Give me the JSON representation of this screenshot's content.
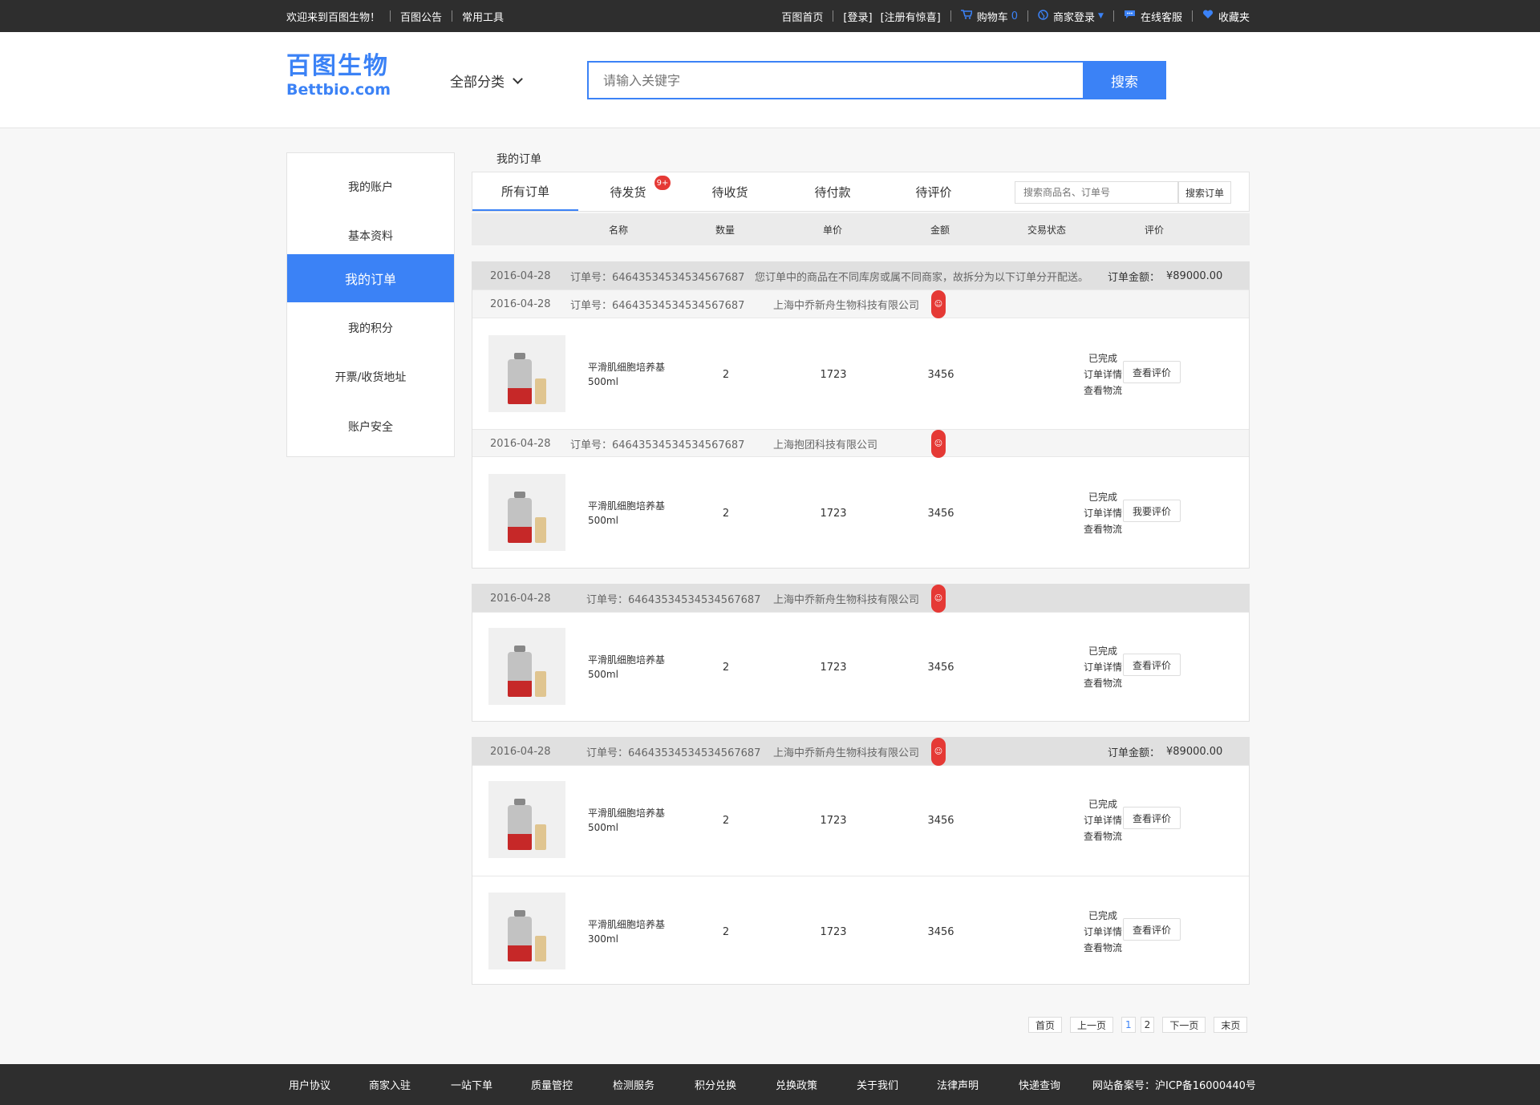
{
  "topbar": {
    "welcome": "欢迎来到百图生物！",
    "notice": "百图公告",
    "tools": "常用工具",
    "home": "百图首页",
    "login": "[登录]",
    "register": "[注册有惊喜]",
    "cart": "购物车",
    "cart_count": "0",
    "merchant_login": "商家登录",
    "service": "在线客服",
    "favorites": "收藏夹"
  },
  "header": {
    "logo_cn": "百图生物",
    "logo_en": "Bettbio.com",
    "category": "全部分类",
    "search_placeholder": "请输入关键字",
    "search_button": "搜索"
  },
  "sidebar": {
    "items": [
      {
        "label": "我的账户"
      },
      {
        "label": "基本资料"
      },
      {
        "label": "我的订单"
      },
      {
        "label": "我的积分"
      },
      {
        "label": "开票/收货地址"
      },
      {
        "label": "账户安全"
      }
    ]
  },
  "main": {
    "title": "我的订单",
    "tabs": [
      {
        "label": "所有订单"
      },
      {
        "label": "待发货",
        "badge": "9+"
      },
      {
        "label": "待收货"
      },
      {
        "label": "待付款"
      },
      {
        "label": "待评价"
      }
    ],
    "order_search_placeholder": "搜索商品名、订单号",
    "order_search_button": "搜索订单",
    "columns": [
      "名称",
      "数量",
      "单价",
      "金额",
      "交易状态",
      "评价"
    ]
  },
  "groups": [
    {
      "parent": {
        "date": "2016-04-28",
        "order_no": "订单号：64643534534534567687",
        "notice": "您订单中的商品在不同库房或属不同商家，故拆分为以下订单分开配送。",
        "total_label": "订单金额：",
        "total": "¥89000.00"
      },
      "subs": [
        {
          "date": "2016-04-28",
          "order_no": "订单号：64643534534534567687",
          "shop": "上海中乔新舟生物科技有限公司",
          "items": [
            {
              "name": "平滑肌细胞培养基",
              "spec": "500ml",
              "qty": "2",
              "price": "1723",
              "amount": "3456",
              "status": "已完成",
              "detail": "订单详情",
              "logistics": "查看物流",
              "action": "查看评价"
            }
          ]
        },
        {
          "date": "2016-04-28",
          "order_no": "订单号：64643534534534567687",
          "shop": "上海抱团科技有限公司",
          "items": [
            {
              "name": "平滑肌细胞培养基",
              "spec": "500ml",
              "qty": "2",
              "price": "1723",
              "amount": "3456",
              "status": "已完成",
              "detail": "订单详情",
              "logistics": "查看物流",
              "action": "我要评价"
            }
          ]
        }
      ]
    },
    {
      "header": {
        "date": "2016-04-28",
        "order_no": "订单号：64643534534534567687",
        "shop": "上海中乔新舟生物科技有限公司"
      },
      "items": [
        {
          "name": "平滑肌细胞培养基",
          "spec": "500ml",
          "qty": "2",
          "price": "1723",
          "amount": "3456",
          "status": "已完成",
          "detail": "订单详情",
          "logistics": "查看物流",
          "action": "查看评价"
        }
      ]
    },
    {
      "header": {
        "date": "2016-04-28",
        "order_no": "订单号：64643534534534567687",
        "shop": "上海中乔新舟生物科技有限公司",
        "total_label": "订单金额：",
        "total": "¥89000.00"
      },
      "items": [
        {
          "name": "平滑肌细胞培养基",
          "spec": "500ml",
          "qty": "2",
          "price": "1723",
          "amount": "3456",
          "status": "已完成",
          "detail": "订单详情",
          "logistics": "查看物流",
          "action": "查看评价"
        },
        {
          "name": "平滑肌细胞培养基",
          "spec": "300ml",
          "qty": "2",
          "price": "1723",
          "amount": "3456",
          "status": "已完成",
          "detail": "订单详情",
          "logistics": "查看物流",
          "action": "查看评价"
        }
      ]
    }
  ],
  "pagination": {
    "first": "首页",
    "prev": "上一页",
    "pages": [
      "1",
      "2"
    ],
    "current": "1",
    "next": "下一页",
    "last": "末页"
  },
  "footer": {
    "links": [
      "用户协议",
      "商家入驻",
      "一站下单",
      "质量管控",
      "检测服务",
      "积分兑换",
      "兑换政策",
      "关于我们",
      "法律声明",
      "快递查询"
    ],
    "icp": "网站备案号：沪ICP备16000440号"
  },
  "colors": {
    "accent": "#3b82f6",
    "topbar_bg": "#2e2e2e",
    "badge_red": "#e53935"
  }
}
